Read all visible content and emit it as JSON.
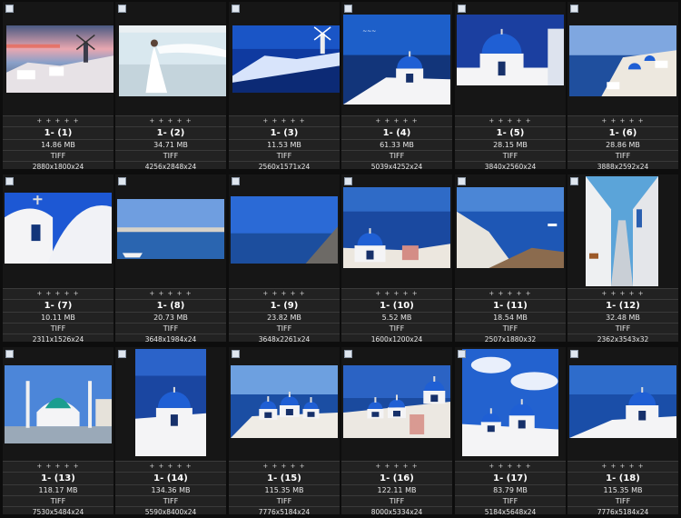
{
  "rating_marks": "+ + + + +",
  "tiles": [
    {
      "name": "1- (1)",
      "size": "14.86 MB",
      "format": "TIFF",
      "dims": "2880x1800x24",
      "scene": "sunset-village"
    },
    {
      "name": "1- (2)",
      "size": "34.71 MB",
      "format": "TIFF",
      "dims": "4256x2848x24",
      "scene": "bride-beach"
    },
    {
      "name": "1- (3)",
      "size": "11.53 MB",
      "format": "TIFF",
      "dims": "2560x1571x24",
      "scene": "blue-night-village"
    },
    {
      "name": "1- (4)",
      "size": "61.33 MB",
      "format": "TIFF",
      "dims": "5039x4252x24",
      "scene": "blue-dome-sea"
    },
    {
      "name": "1- (5)",
      "size": "28.15 MB",
      "format": "TIFF",
      "dims": "3840x2560x24",
      "scene": "blue-dome-close"
    },
    {
      "name": "1- (6)",
      "size": "28.86 MB",
      "format": "TIFF",
      "dims": "3888x2592x24",
      "scene": "cliff-village"
    },
    {
      "name": "1- (7)",
      "size": "10.11 MB",
      "format": "TIFF",
      "dims": "2311x1526x24",
      "scene": "white-chapel"
    },
    {
      "name": "1- (8)",
      "size": "20.73 MB",
      "format": "TIFF",
      "dims": "3648x1984x24",
      "scene": "harbor-town"
    },
    {
      "name": "1- (9)",
      "size": "23.82 MB",
      "format": "TIFF",
      "dims": "3648x2261x24",
      "scene": "sea-coast"
    },
    {
      "name": "1- (10)",
      "size": "5.52 MB",
      "format": "TIFF",
      "dims": "1600x1200x24",
      "scene": "dome-caldera"
    },
    {
      "name": "1- (11)",
      "size": "18.54 MB",
      "format": "TIFF",
      "dims": "2507x1880x32",
      "scene": "caldera-view"
    },
    {
      "name": "1- (12)",
      "size": "32.48 MB",
      "format": "TIFF",
      "dims": "2362x3543x32",
      "scene": "narrow-alley"
    },
    {
      "name": "1- (13)",
      "size": "118.17 MB",
      "format": "TIFF",
      "dims": "7530x5484x24",
      "scene": "mosque"
    },
    {
      "name": "1- (14)",
      "size": "134.36 MB",
      "format": "TIFF",
      "dims": "5590x8400x24",
      "scene": "dome-portrait"
    },
    {
      "name": "1- (15)",
      "size": "115.35 MB",
      "format": "TIFF",
      "dims": "7776x5184x24",
      "scene": "domes-bay"
    },
    {
      "name": "1- (16)",
      "size": "122.11 MB",
      "format": "TIFF",
      "dims": "8000x5334x24",
      "scene": "domes-village"
    },
    {
      "name": "1- (17)",
      "size": "83.79 MB",
      "format": "TIFF",
      "dims": "5184x5648x24",
      "scene": "domes-clouds"
    },
    {
      "name": "1- (18)",
      "size": "115.35 MB",
      "format": "TIFF",
      "dims": "7776x5184x24",
      "scene": "dome-sea-wide"
    }
  ],
  "colors": {
    "sky_blue": "#1d5fc9",
    "deep_sea": "#12357a",
    "dome_blue": "#1f5fd4",
    "white_wall": "#f4f4f6",
    "sunset_pink": "#e9a7b0"
  }
}
